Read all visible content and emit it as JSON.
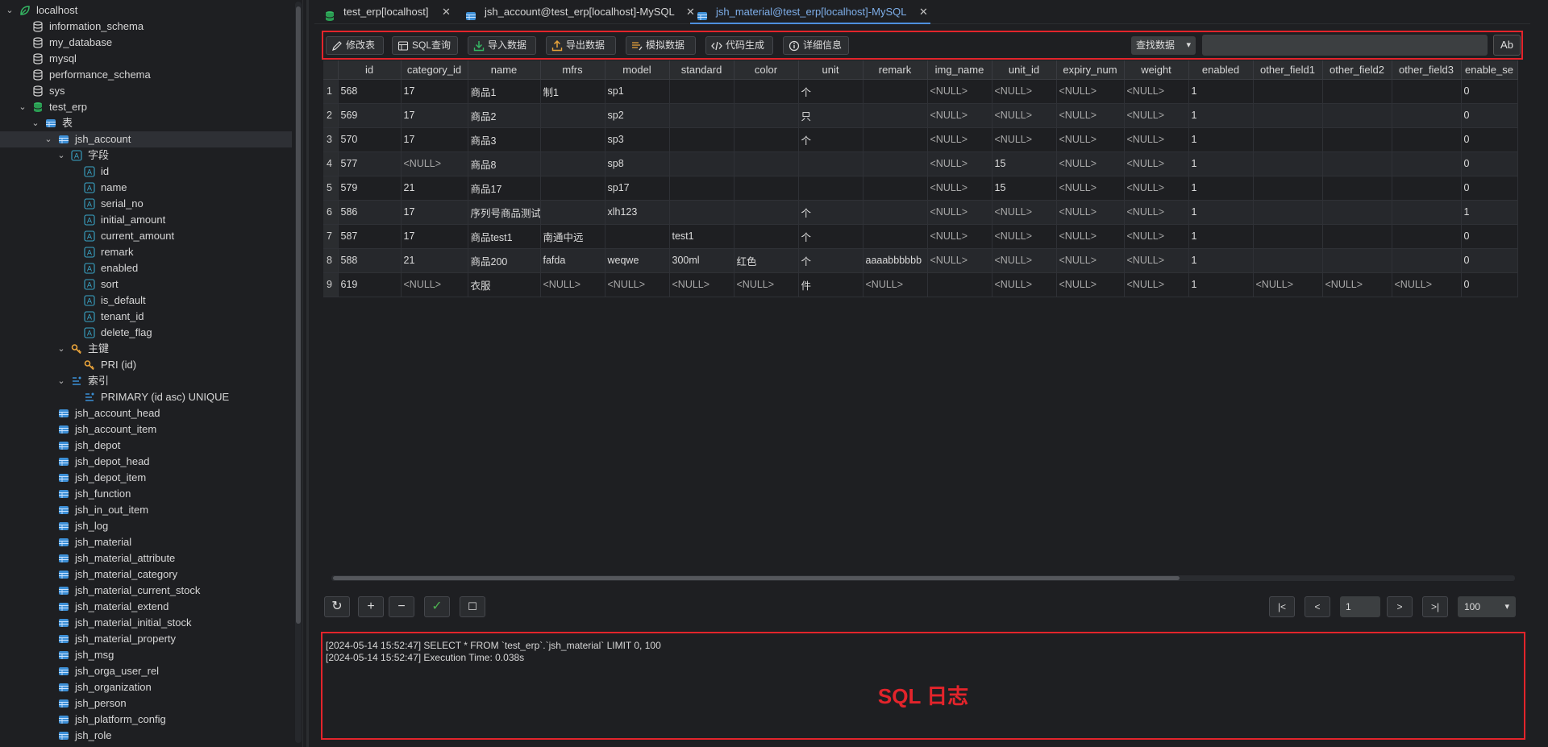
{
  "sidebar": {
    "tree": [
      {
        "label": "localhost",
        "icon": "connection-leaf-icon",
        "level": 0,
        "arrow": "v",
        "color": "#35b864"
      },
      {
        "label": "information_schema",
        "icon": "database-icon",
        "level": 1,
        "arrow": ""
      },
      {
        "label": "my_database",
        "icon": "database-icon",
        "level": 1,
        "arrow": ""
      },
      {
        "label": "mysql",
        "icon": "database-icon",
        "level": 1,
        "arrow": ""
      },
      {
        "label": "performance_schema",
        "icon": "database-icon",
        "level": 1,
        "arrow": ""
      },
      {
        "label": "sys",
        "icon": "database-icon",
        "level": 1,
        "arrow": ""
      },
      {
        "label": "test_erp",
        "icon": "database-active-icon",
        "level": 1,
        "arrow": "v"
      },
      {
        "label": "表",
        "icon": "tables-folder-icon",
        "level": 2,
        "arrow": "v"
      },
      {
        "label": "jsh_account",
        "icon": "table-icon",
        "level": 3,
        "arrow": "v",
        "selected": true
      },
      {
        "label": "字段",
        "icon": "columns-folder-icon",
        "level": 4,
        "arrow": "v"
      },
      {
        "label": "id",
        "icon": "column-icon",
        "level": 5,
        "arrow": ""
      },
      {
        "label": "name",
        "icon": "column-icon",
        "level": 5,
        "arrow": ""
      },
      {
        "label": "serial_no",
        "icon": "column-icon",
        "level": 5,
        "arrow": ""
      },
      {
        "label": "initial_amount",
        "icon": "column-icon",
        "level": 5,
        "arrow": ""
      },
      {
        "label": "current_amount",
        "icon": "column-icon",
        "level": 5,
        "arrow": ""
      },
      {
        "label": "remark",
        "icon": "column-icon",
        "level": 5,
        "arrow": ""
      },
      {
        "label": "enabled",
        "icon": "column-icon",
        "level": 5,
        "arrow": ""
      },
      {
        "label": "sort",
        "icon": "column-icon",
        "level": 5,
        "arrow": ""
      },
      {
        "label": "is_default",
        "icon": "column-icon",
        "level": 5,
        "arrow": ""
      },
      {
        "label": "tenant_id",
        "icon": "column-icon",
        "level": 5,
        "arrow": ""
      },
      {
        "label": "delete_flag",
        "icon": "column-icon",
        "level": 5,
        "arrow": ""
      },
      {
        "label": "主键",
        "icon": "key-icon",
        "level": 4,
        "arrow": "v"
      },
      {
        "label": "PRI  (id)",
        "icon": "key-icon",
        "level": 5,
        "arrow": ""
      },
      {
        "label": "索引",
        "icon": "index-icon",
        "level": 4,
        "arrow": "v"
      },
      {
        "label": "PRIMARY  (id asc) UNIQUE",
        "icon": "index-icon",
        "level": 5,
        "arrow": ""
      },
      {
        "label": "jsh_account_head",
        "icon": "table-icon",
        "level": 3,
        "arrow": ""
      },
      {
        "label": "jsh_account_item",
        "icon": "table-icon",
        "level": 3,
        "arrow": ""
      },
      {
        "label": "jsh_depot",
        "icon": "table-icon",
        "level": 3,
        "arrow": ""
      },
      {
        "label": "jsh_depot_head",
        "icon": "table-icon",
        "level": 3,
        "arrow": ""
      },
      {
        "label": "jsh_depot_item",
        "icon": "table-icon",
        "level": 3,
        "arrow": ""
      },
      {
        "label": "jsh_function",
        "icon": "table-icon",
        "level": 3,
        "arrow": ""
      },
      {
        "label": "jsh_in_out_item",
        "icon": "table-icon",
        "level": 3,
        "arrow": ""
      },
      {
        "label": "jsh_log",
        "icon": "table-icon",
        "level": 3,
        "arrow": ""
      },
      {
        "label": "jsh_material",
        "icon": "table-icon",
        "level": 3,
        "arrow": ""
      },
      {
        "label": "jsh_material_attribute",
        "icon": "table-icon",
        "level": 3,
        "arrow": ""
      },
      {
        "label": "jsh_material_category",
        "icon": "table-icon",
        "level": 3,
        "arrow": ""
      },
      {
        "label": "jsh_material_current_stock",
        "icon": "table-icon",
        "level": 3,
        "arrow": ""
      },
      {
        "label": "jsh_material_extend",
        "icon": "table-icon",
        "level": 3,
        "arrow": ""
      },
      {
        "label": "jsh_material_initial_stock",
        "icon": "table-icon",
        "level": 3,
        "arrow": ""
      },
      {
        "label": "jsh_material_property",
        "icon": "table-icon",
        "level": 3,
        "arrow": ""
      },
      {
        "label": "jsh_msg",
        "icon": "table-icon",
        "level": 3,
        "arrow": ""
      },
      {
        "label": "jsh_orga_user_rel",
        "icon": "table-icon",
        "level": 3,
        "arrow": ""
      },
      {
        "label": "jsh_organization",
        "icon": "table-icon",
        "level": 3,
        "arrow": ""
      },
      {
        "label": "jsh_person",
        "icon": "table-icon",
        "level": 3,
        "arrow": ""
      },
      {
        "label": "jsh_platform_config",
        "icon": "table-icon",
        "level": 3,
        "arrow": ""
      },
      {
        "label": "jsh_role",
        "icon": "table-icon",
        "level": 3,
        "arrow": ""
      }
    ]
  },
  "tabs": [
    {
      "label": "test_erp[localhost]",
      "icon": "database-icon",
      "close": "✕",
      "active": false
    },
    {
      "label": "jsh_account@test_erp[localhost]-MySQL",
      "icon": "table-icon",
      "close": "✕",
      "active": false
    },
    {
      "label": "jsh_material@test_erp[localhost]-MySQL",
      "icon": "table-icon",
      "close": "✕",
      "active": true
    }
  ],
  "toolbar": {
    "buttons": [
      {
        "label": "修改表",
        "icon": "pencil-icon"
      },
      {
        "label": "SQL查询",
        "icon": "sql-query-icon"
      },
      {
        "label": "导入数据",
        "icon": "import-icon"
      },
      {
        "label": "导出数据",
        "icon": "export-icon"
      },
      {
        "label": "模拟数据",
        "icon": "mock-data-icon"
      },
      {
        "label": "代码生成",
        "icon": "code-icon"
      },
      {
        "label": "详细信息",
        "icon": "info-icon"
      }
    ],
    "search_type": "查找数据",
    "search_value": "",
    "match_case": "Ab"
  },
  "grid": {
    "columns": [
      "id",
      "category_id",
      "name",
      "mfrs",
      "model",
      "standard",
      "color",
      "unit",
      "remark",
      "img_name",
      "unit_id",
      "expiry_num",
      "weight",
      "enabled",
      "other_field1",
      "other_field2",
      "other_field3",
      "enable_se"
    ],
    "rows": [
      [
        "1",
        "568",
        "17",
        "商品1",
        "制1",
        "sp1",
        "",
        "",
        "个",
        "",
        "<NULL>",
        "<NULL>",
        "<NULL>",
        "<NULL>",
        "1",
        "",
        "",
        "",
        "0"
      ],
      [
        "2",
        "569",
        "17",
        "商品2",
        "",
        "sp2",
        "",
        "",
        "只",
        "",
        "<NULL>",
        "<NULL>",
        "<NULL>",
        "<NULL>",
        "1",
        "",
        "",
        "",
        "0"
      ],
      [
        "3",
        "570",
        "17",
        "商品3",
        "",
        "sp3",
        "",
        "",
        "个",
        "",
        "<NULL>",
        "<NULL>",
        "<NULL>",
        "<NULL>",
        "1",
        "",
        "",
        "",
        "0"
      ],
      [
        "4",
        "577",
        "<NULL>",
        "商品8",
        "",
        "sp8",
        "",
        "",
        "",
        "",
        "<NULL>",
        "15",
        "<NULL>",
        "<NULL>",
        "1",
        "",
        "",
        "",
        "0"
      ],
      [
        "5",
        "579",
        "21",
        "商品17",
        "",
        "sp17",
        "",
        "",
        "",
        "",
        "<NULL>",
        "15",
        "<NULL>",
        "<NULL>",
        "1",
        "",
        "",
        "",
        "0"
      ],
      [
        "6",
        "586",
        "17",
        "序列号商品测试",
        "",
        "xlh123",
        "",
        "",
        "个",
        "",
        "<NULL>",
        "<NULL>",
        "<NULL>",
        "<NULL>",
        "1",
        "",
        "",
        "",
        "1"
      ],
      [
        "7",
        "587",
        "17",
        "商品test1",
        "南通中远",
        "",
        "test1",
        "",
        "个",
        "",
        "<NULL>",
        "<NULL>",
        "<NULL>",
        "<NULL>",
        "1",
        "",
        "",
        "",
        "0"
      ],
      [
        "8",
        "588",
        "21",
        "商品200",
        "fafda",
        "weqwe",
        "300ml",
        "红色",
        "个",
        "aaaabbbbbb",
        "<NULL>",
        "<NULL>",
        "<NULL>",
        "<NULL>",
        "1",
        "",
        "",
        "",
        "0"
      ],
      [
        "9",
        "619",
        "<NULL>",
        "衣服",
        "<NULL>",
        "<NULL>",
        "<NULL>",
        "<NULL>",
        "件",
        "<NULL>",
        "",
        "<NULL>",
        "<NULL>",
        "<NULL>",
        "1",
        "<NULL>",
        "<NULL>",
        "<NULL>",
        "0"
      ]
    ]
  },
  "pagination": {
    "refresh": "↻",
    "add": "+",
    "remove": "−",
    "commit": "✓",
    "cancel": "☐",
    "first": "|<",
    "prev": "<",
    "page": "1",
    "next": ">",
    "last": ">|",
    "page_size": "100"
  },
  "log": {
    "lines": [
      "[2024-05-14 15:52:47] SELECT * FROM `test_erp`.`jsh_material`  LIMIT 0, 100",
      "[2024-05-14 15:52:47] Execution Time: 0.038s"
    ],
    "caption": "SQL 日志"
  },
  "colors": {
    "highlight": "#e3242b",
    "accent": "#4e8fde",
    "column_icon": "#3aa7c9"
  }
}
